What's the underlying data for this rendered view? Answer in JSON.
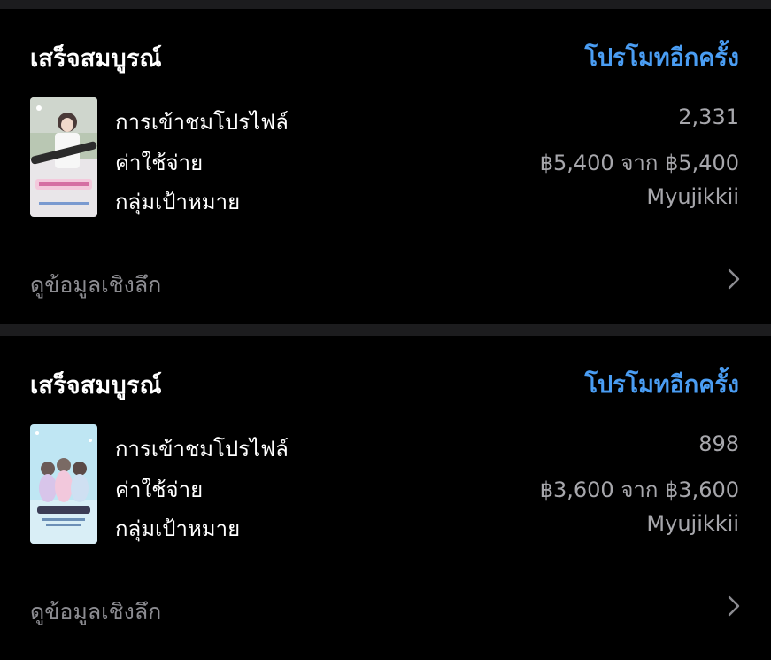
{
  "cards": [
    {
      "status": "เสร็จสมบูรณ์",
      "promote_again": "โปรโมทอีกครั้ง",
      "rows": [
        {
          "label": "การเข้าชมโปรไฟล์",
          "value": "2,331"
        },
        {
          "label": "ค่าใช้จ่าย",
          "value": "฿5,400 จาก ฿5,400"
        },
        {
          "label": "กลุ่มเป้าหมาย",
          "value": "Myujikkii"
        }
      ],
      "view_insights": "ดูข้อมูลเชิงลึก"
    },
    {
      "status": "เสร็จสมบูรณ์",
      "promote_again": "โปรโมทอีกครั้ง",
      "rows": [
        {
          "label": "การเข้าชมโปรไฟล์",
          "value": "898"
        },
        {
          "label": "ค่าใช้จ่าย",
          "value": "฿3,600 จาก ฿3,600"
        },
        {
          "label": "กลุ่มเป้าหมาย",
          "value": "Myujikkii"
        }
      ],
      "view_insights": "ดูข้อมูลเชิงลึก"
    }
  ],
  "colors": {
    "background": "#000000",
    "separator": "#1c1c1e",
    "accent": "#4a9df3",
    "secondary_text": "#a7a7ac",
    "muted_text": "#8c8c91"
  },
  "icons": {
    "chevron": "chevron-right-icon"
  }
}
